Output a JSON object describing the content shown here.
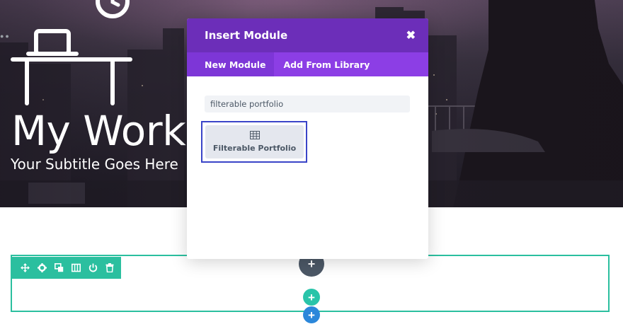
{
  "hero": {
    "title": "My Work",
    "subtitle": "Your Subtitle Goes Here",
    "icon": "desk-icon"
  },
  "modal": {
    "title": "Insert Module",
    "close_icon": "close-icon",
    "tabs": [
      {
        "label": "New Module",
        "active": true
      },
      {
        "label": "Add From Library",
        "active": false
      }
    ],
    "search_value": "filterable portfolio",
    "modules": [
      {
        "label": "Filterable Portfolio",
        "icon": "grid-icon"
      }
    ]
  },
  "row_toolbar": {
    "icons": [
      "move-icon",
      "settings-icon",
      "duplicate-icon",
      "columns-icon",
      "save-icon",
      "delete-icon"
    ]
  },
  "buttons": {
    "add_module": "+",
    "add_row": "+",
    "add_section": "+"
  },
  "colors": {
    "modal_header": "#6c2eb9",
    "modal_tabs": "#8c3ee5",
    "row_accent": "#2bbf9f",
    "add_section": "#2b87da",
    "selection_outline": "#3a44c8"
  }
}
